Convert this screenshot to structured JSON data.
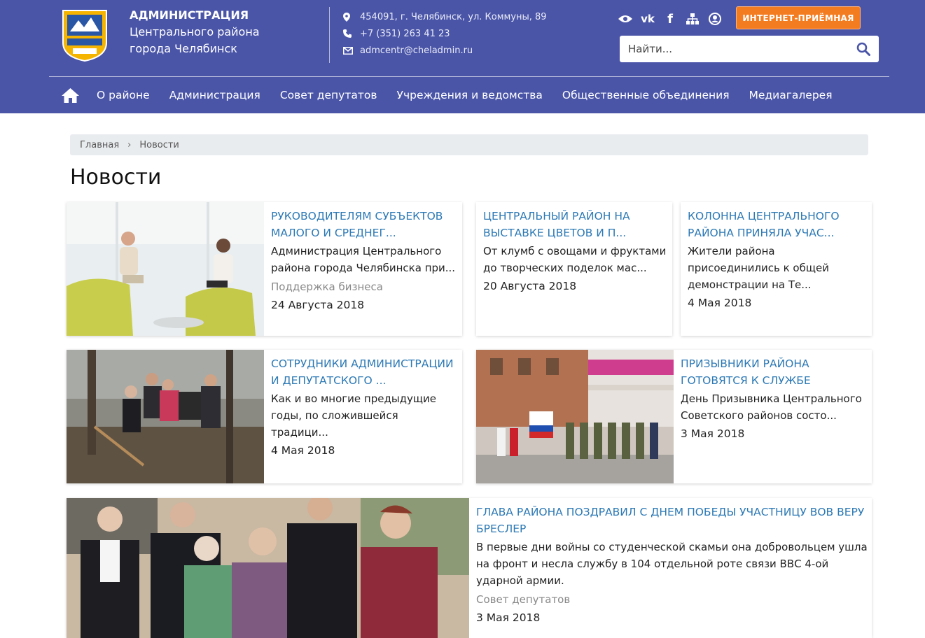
{
  "header": {
    "org_line1": "АДМИНИСТРАЦИЯ",
    "org_line2": "Центрального района",
    "org_line3": "города Челябинск",
    "address": "454091, г. Челябинск, ул. Коммуны, 89",
    "phone": "+7 (351) 263 41 23",
    "email": "admcentr@cheladmin.ru",
    "reception_button": "ИНТЕРНЕТ-ПРИЁМНАЯ",
    "search_placeholder": "Найти...",
    "social_icons": [
      "eye-icon",
      "vk-icon",
      "facebook-icon",
      "sitemap-icon",
      "user-icon"
    ]
  },
  "nav": {
    "items": [
      "О районе",
      "Администрация",
      "Совет депутатов",
      "Учреждения и ведомства",
      "Общественные объединения",
      "Медиагалерея"
    ]
  },
  "breadcrumb": {
    "home": "Главная",
    "separator": "›",
    "current": "Новости"
  },
  "page": {
    "title": "Новости"
  },
  "news": [
    {
      "title": "РУКОВОДИТЕЛЯМ СУБЪЕКТОВ МАЛОГО И СРЕДНЕГ...",
      "desc": "Администрация Центрального района города Челябинска при...",
      "category": "Поддержка бизнеса",
      "date": "24 Августа 2018"
    },
    {
      "title": "ЦЕНТРАЛЬНЫЙ РАЙОН НА ВЫСТАВКЕ ЦВЕТОВ И П...",
      "desc": "От клумб с овощами и фруктами до творческих поделок мас...",
      "category": "",
      "date": "20 Августа 2018"
    },
    {
      "title": "КОЛОННА ЦЕНТРАЛЬНОГО РАЙОНА ПРИНЯЛА УЧАС...",
      "desc": "Жители района присоединились к общей демонстрации на Те...",
      "category": "",
      "date": "4 Мая 2018"
    },
    {
      "title": "СОТРУДНИКИ АДМИНИСТРАЦИИ И ДЕПУТАТСКОГО ...",
      "desc": "Как и во многие предыдущие годы, по сложившейся традици...",
      "category": "",
      "date": "4 Мая 2018"
    },
    {
      "title": "ПРИЗЫВНИКИ РАЙОНА ГОТОВЯТСЯ К СЛУЖБЕ",
      "desc": "День Призывника Центрального Советского районов состо...",
      "category": "",
      "date": "3 Мая 2018"
    },
    {
      "title": "ГЛАВА РАЙОНА ПОЗДРАВИЛ С ДНЕМ ПОБЕДЫ УЧАСТНИЦУ ВОВ ВЕРУ БРЕСЛЕР",
      "desc": "В первые дни войны со студенческой скамьи она добровольцем ушла на фронт и несла службу в 104 отдельной роте связи ВВС 4-ой ударной армии.",
      "category": "Совет депутатов",
      "date": "3 Мая 2018"
    }
  ]
}
